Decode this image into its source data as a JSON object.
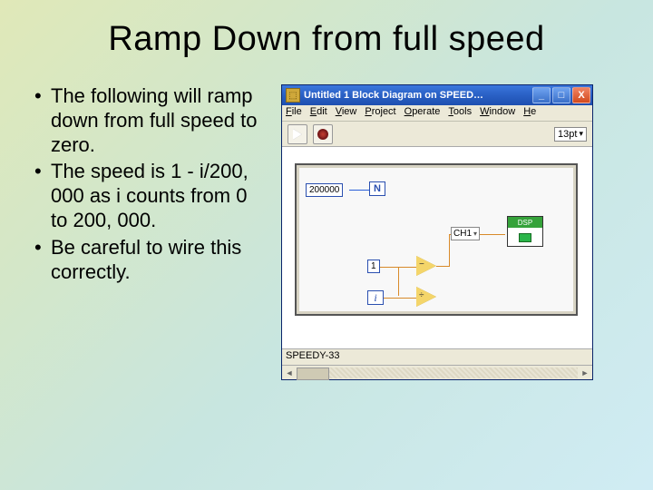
{
  "title": "Ramp Down from full speed",
  "bullets": [
    "The following will ramp down from full speed to zero.",
    "The speed is    1 - i/200, 000 as i counts from 0 to 200, 000.",
    "Be careful to wire this correctly."
  ],
  "window": {
    "title": "Untitled 1 Block Diagram on SPEED…",
    "menu": [
      "File",
      "Edit",
      "View",
      "Project",
      "Operate",
      "Tools",
      "Window",
      "He"
    ],
    "font_size": "13pt",
    "status": "SPEEDY-33"
  },
  "diagram": {
    "loop_count": "200000",
    "one": "1",
    "i": "i",
    "n": "N",
    "channel": "CH1",
    "dsp": "DSP"
  }
}
